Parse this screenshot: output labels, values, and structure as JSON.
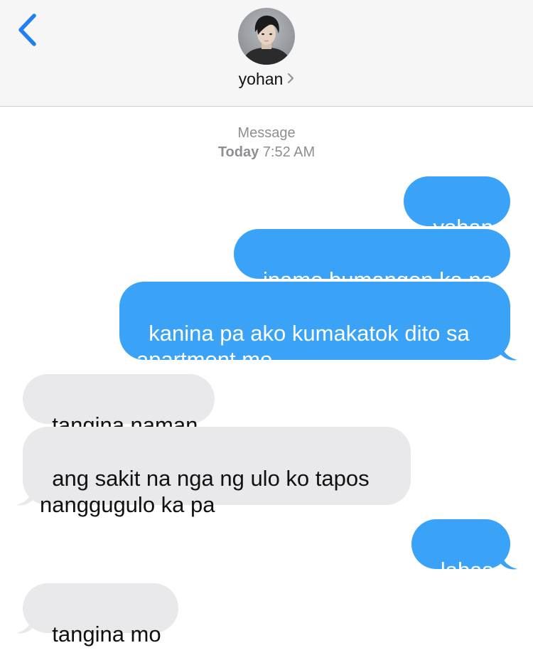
{
  "header": {
    "contact_name": "yohan",
    "back_icon": "chevron-left-icon",
    "details_icon": "chevron-right-icon"
  },
  "thread": {
    "service_label": "Message",
    "date_label": "Today",
    "time_label": "7:52 AM"
  },
  "colors": {
    "outgoing_bubble": "#3aa3f7",
    "incoming_bubble": "#e9e9eb",
    "accent": "#1f7ff3"
  },
  "messages": [
    {
      "direction": "outgoing",
      "text": "yohan"
    },
    {
      "direction": "outgoing",
      "text": "inamo bumangon ka na"
    },
    {
      "direction": "outgoing",
      "text": "kanina pa ako kumakatok dito sa\napartment mo"
    },
    {
      "direction": "incoming",
      "text": "tangina naman"
    },
    {
      "direction": "incoming",
      "text": "ang sakit na nga ng ulo ko tapos\nnanggugulo ka pa"
    },
    {
      "direction": "outgoing",
      "text": "labas"
    },
    {
      "direction": "incoming",
      "text": "tangina mo"
    }
  ]
}
